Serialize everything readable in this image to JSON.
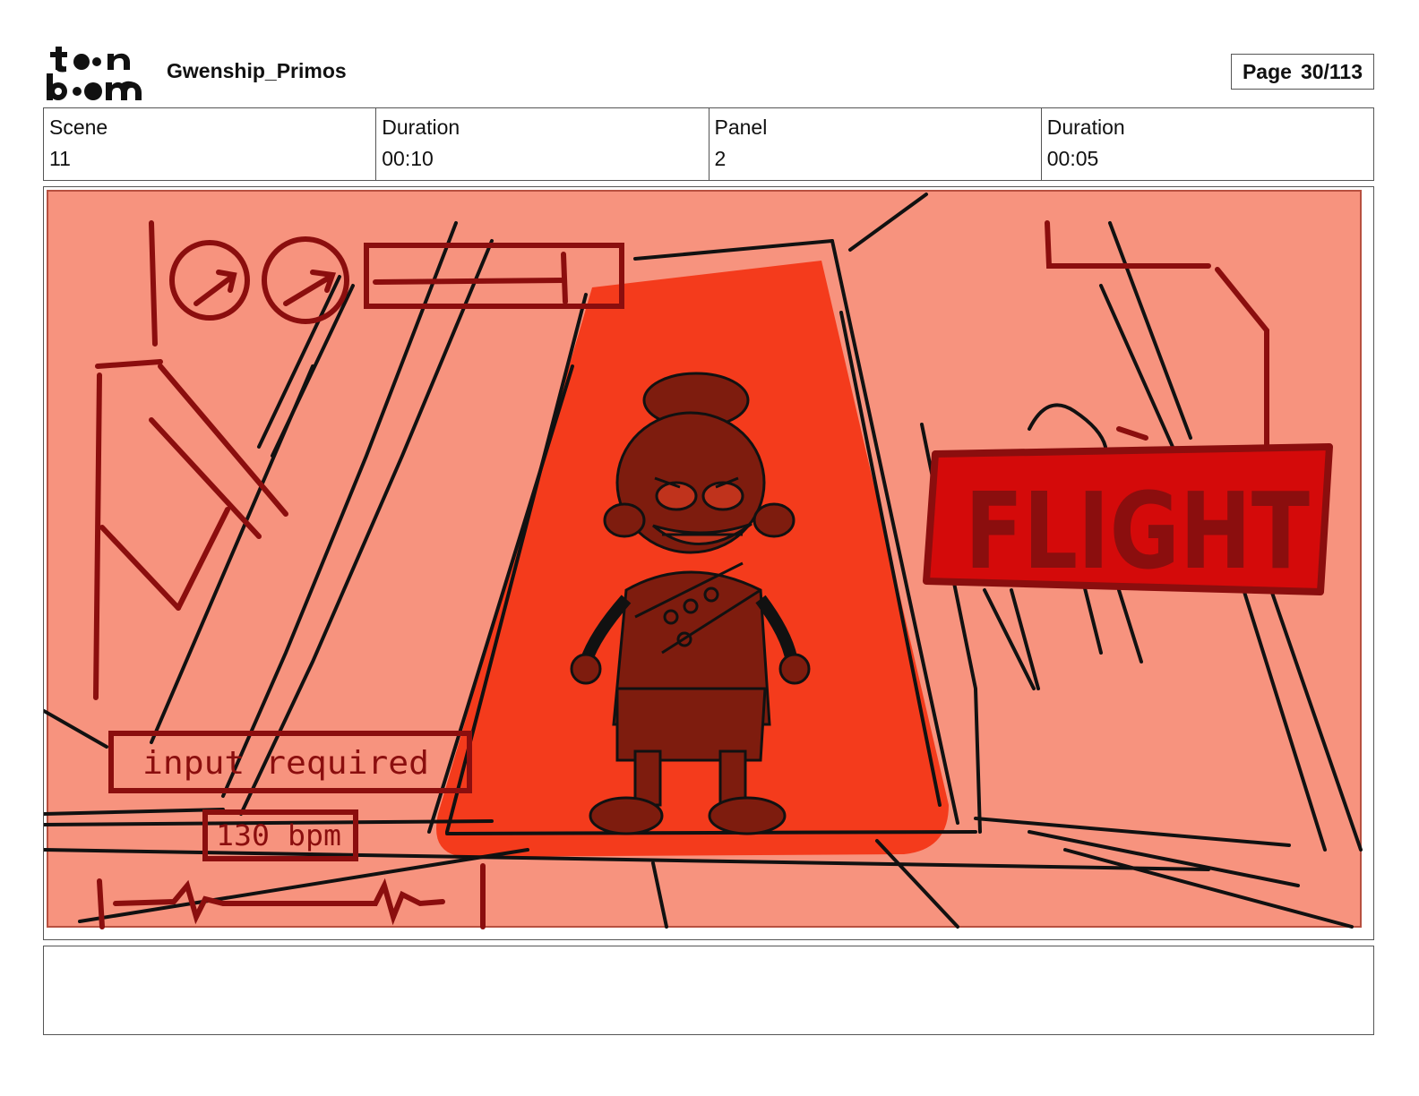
{
  "header": {
    "logo_text": "toonboom",
    "project_title": "Gwenship_Primos",
    "page_label": "Page",
    "page_value": "30/113"
  },
  "info": {
    "cells": [
      {
        "label": "Scene",
        "value": "11"
      },
      {
        "label": "Duration",
        "value": "00:10"
      },
      {
        "label": "Panel",
        "value": "2"
      },
      {
        "label": "Duration",
        "value": "00:05"
      }
    ]
  },
  "panel": {
    "hud_text": "input required",
    "bpm_text": "130 bpm",
    "sign_text": "FLIGHT",
    "colors": {
      "background": "#F7937E",
      "spotlight": "#F43B1C",
      "sign": "#D40A0A",
      "dark_red": "#8B0E0E",
      "character": "#7E1C0E",
      "line": "#111111"
    }
  },
  "notes": {
    "text": ""
  }
}
